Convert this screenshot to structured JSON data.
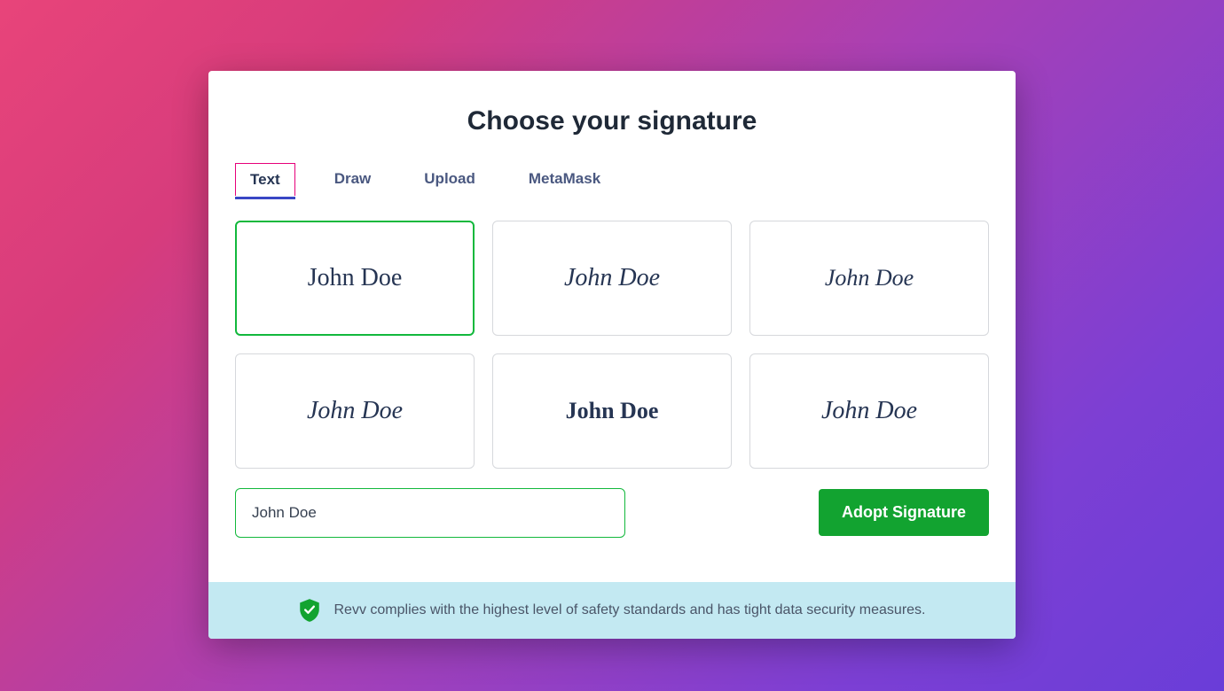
{
  "title": "Choose your signature",
  "tabs": [
    {
      "label": "Text",
      "active": true
    },
    {
      "label": "Draw",
      "active": false
    },
    {
      "label": "Upload",
      "active": false
    },
    {
      "label": "MetaMask",
      "active": false
    }
  ],
  "signature_name": "John Doe",
  "signature_options": [
    {
      "text": "John Doe",
      "selected": true
    },
    {
      "text": "John Doe",
      "selected": false
    },
    {
      "text": "John Doe",
      "selected": false
    },
    {
      "text": "John Doe",
      "selected": false
    },
    {
      "text": "John Doe",
      "selected": false
    },
    {
      "text": "John Doe",
      "selected": false
    }
  ],
  "input_value": "John Doe",
  "adopt_button_label": "Adopt Signature",
  "footer_text": "Revv complies with the highest level of safety standards and has tight data security measures.",
  "colors": {
    "accent_green": "#12a330",
    "border_green": "#12b83c",
    "tab_underline": "#3947c5",
    "tab_border_active": "#e6007a"
  }
}
